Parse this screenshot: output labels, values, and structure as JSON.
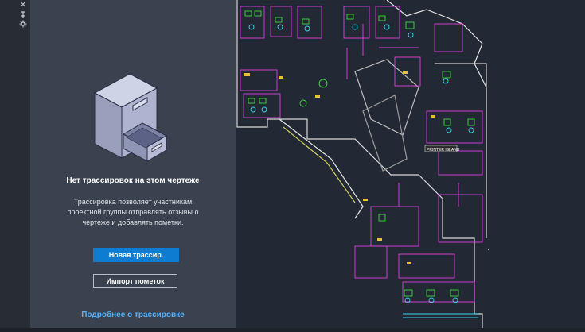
{
  "panel": {
    "title": "Нет трассировок на этом чертеже",
    "description": "Трассировка позволяет участникам проектной группы отправлять отзывы о чертеже и добавлять пометки.",
    "new_trace_button": "Новая трассир.",
    "import_markups_button": "Импорт пометок",
    "learn_more_link": "Подробнее о трассировке"
  },
  "drawing": {
    "room_label": "PRINTER ISLAND"
  },
  "colors": {
    "panel_bg": "#3a424f",
    "canvas_bg": "#222834",
    "primary_button": "#0d7cd1",
    "link": "#5aaff5"
  },
  "icons": [
    "close-icon",
    "pin-icon",
    "settings-icon",
    "file-cabinet-icon"
  ]
}
